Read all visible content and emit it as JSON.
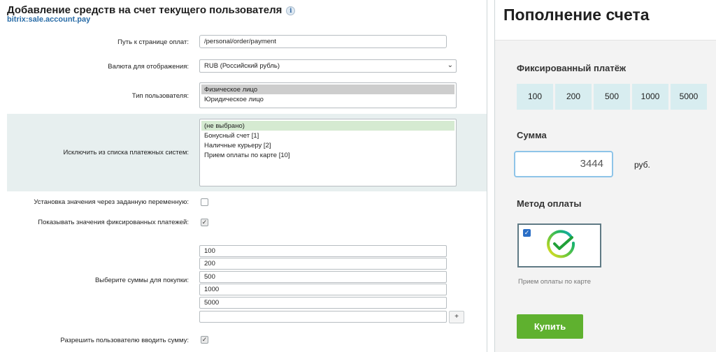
{
  "left": {
    "title": "Добавление средств на счет текущего пользователя",
    "info_icon": "i",
    "component_code": "bitrix:sale.account.pay",
    "payment_path": {
      "label": "Путь к странице оплат:",
      "value": "/personal/order/payment"
    },
    "currency": {
      "label": "Валюта для отображения:",
      "value": "RUB (Российский рубль)"
    },
    "user_type": {
      "label": "Тип пользователя:",
      "options": [
        "Физическое лицо",
        "Юридическое лицо"
      ]
    },
    "exclude_systems": {
      "label": "Исключить из списка платежных систем:",
      "options": [
        "(не выбрано)",
        "Бонусный счет [1]",
        "Наличные курьеру [2]",
        "Прием оплаты по карте [10]"
      ]
    },
    "var_setting": {
      "label": "Установка значения через заданную переменную:"
    },
    "show_fixed": {
      "label": "Показывать значения фиксированных платежей:",
      "check": "✓"
    },
    "amounts": {
      "label": "Выберите суммы для покупки:",
      "values": [
        "100",
        "200",
        "500",
        "1000",
        "5000",
        ""
      ]
    },
    "add_button": "+",
    "allow_input": {
      "label": "Разрешить пользователю вводить сумму:",
      "check": "✓"
    }
  },
  "right": {
    "title": "Пополнение счета",
    "fixed_heading": "Фиксированный платёж",
    "chips": [
      "100",
      "200",
      "500",
      "1000",
      "5000"
    ],
    "sum_heading": "Сумма",
    "sum_value": "3444",
    "currency_label": "руб.",
    "method_heading": "Метод оплаты",
    "method_check": "✓",
    "method_caption": "Прием оплаты по карте",
    "buy_button": "Купить"
  },
  "colors": {
    "accent_green": "#5fb12f",
    "chip_bg": "#d8edf0",
    "link_blue": "#2a6da8"
  }
}
